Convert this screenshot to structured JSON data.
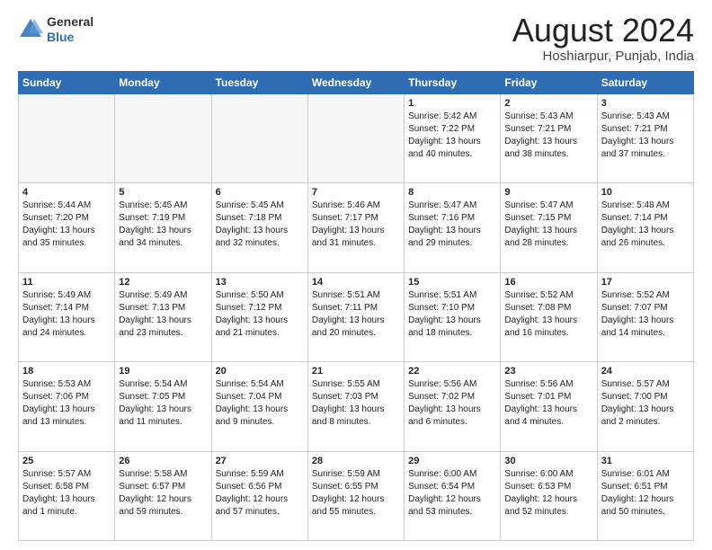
{
  "header": {
    "logo_line1": "General",
    "logo_line2": "Blue",
    "month_title": "August 2024",
    "location": "Hoshiarpur, Punjab, India"
  },
  "days_of_week": [
    "Sunday",
    "Monday",
    "Tuesday",
    "Wednesday",
    "Thursday",
    "Friday",
    "Saturday"
  ],
  "weeks": [
    [
      {
        "num": "",
        "detail": ""
      },
      {
        "num": "",
        "detail": ""
      },
      {
        "num": "",
        "detail": ""
      },
      {
        "num": "",
        "detail": ""
      },
      {
        "num": "1",
        "detail": "Sunrise: 5:42 AM\nSunset: 7:22 PM\nDaylight: 13 hours\nand 40 minutes."
      },
      {
        "num": "2",
        "detail": "Sunrise: 5:43 AM\nSunset: 7:21 PM\nDaylight: 13 hours\nand 38 minutes."
      },
      {
        "num": "3",
        "detail": "Sunrise: 5:43 AM\nSunset: 7:21 PM\nDaylight: 13 hours\nand 37 minutes."
      }
    ],
    [
      {
        "num": "4",
        "detail": "Sunrise: 5:44 AM\nSunset: 7:20 PM\nDaylight: 13 hours\nand 35 minutes."
      },
      {
        "num": "5",
        "detail": "Sunrise: 5:45 AM\nSunset: 7:19 PM\nDaylight: 13 hours\nand 34 minutes."
      },
      {
        "num": "6",
        "detail": "Sunrise: 5:45 AM\nSunset: 7:18 PM\nDaylight: 13 hours\nand 32 minutes."
      },
      {
        "num": "7",
        "detail": "Sunrise: 5:46 AM\nSunset: 7:17 PM\nDaylight: 13 hours\nand 31 minutes."
      },
      {
        "num": "8",
        "detail": "Sunrise: 5:47 AM\nSunset: 7:16 PM\nDaylight: 13 hours\nand 29 minutes."
      },
      {
        "num": "9",
        "detail": "Sunrise: 5:47 AM\nSunset: 7:15 PM\nDaylight: 13 hours\nand 28 minutes."
      },
      {
        "num": "10",
        "detail": "Sunrise: 5:48 AM\nSunset: 7:14 PM\nDaylight: 13 hours\nand 26 minutes."
      }
    ],
    [
      {
        "num": "11",
        "detail": "Sunrise: 5:49 AM\nSunset: 7:14 PM\nDaylight: 13 hours\nand 24 minutes."
      },
      {
        "num": "12",
        "detail": "Sunrise: 5:49 AM\nSunset: 7:13 PM\nDaylight: 13 hours\nand 23 minutes."
      },
      {
        "num": "13",
        "detail": "Sunrise: 5:50 AM\nSunset: 7:12 PM\nDaylight: 13 hours\nand 21 minutes."
      },
      {
        "num": "14",
        "detail": "Sunrise: 5:51 AM\nSunset: 7:11 PM\nDaylight: 13 hours\nand 20 minutes."
      },
      {
        "num": "15",
        "detail": "Sunrise: 5:51 AM\nSunset: 7:10 PM\nDaylight: 13 hours\nand 18 minutes."
      },
      {
        "num": "16",
        "detail": "Sunrise: 5:52 AM\nSunset: 7:08 PM\nDaylight: 13 hours\nand 16 minutes."
      },
      {
        "num": "17",
        "detail": "Sunrise: 5:52 AM\nSunset: 7:07 PM\nDaylight: 13 hours\nand 14 minutes."
      }
    ],
    [
      {
        "num": "18",
        "detail": "Sunrise: 5:53 AM\nSunset: 7:06 PM\nDaylight: 13 hours\nand 13 minutes."
      },
      {
        "num": "19",
        "detail": "Sunrise: 5:54 AM\nSunset: 7:05 PM\nDaylight: 13 hours\nand 11 minutes."
      },
      {
        "num": "20",
        "detail": "Sunrise: 5:54 AM\nSunset: 7:04 PM\nDaylight: 13 hours\nand 9 minutes."
      },
      {
        "num": "21",
        "detail": "Sunrise: 5:55 AM\nSunset: 7:03 PM\nDaylight: 13 hours\nand 8 minutes."
      },
      {
        "num": "22",
        "detail": "Sunrise: 5:56 AM\nSunset: 7:02 PM\nDaylight: 13 hours\nand 6 minutes."
      },
      {
        "num": "23",
        "detail": "Sunrise: 5:56 AM\nSunset: 7:01 PM\nDaylight: 13 hours\nand 4 minutes."
      },
      {
        "num": "24",
        "detail": "Sunrise: 5:57 AM\nSunset: 7:00 PM\nDaylight: 13 hours\nand 2 minutes."
      }
    ],
    [
      {
        "num": "25",
        "detail": "Sunrise: 5:57 AM\nSunset: 6:58 PM\nDaylight: 13 hours\nand 1 minute."
      },
      {
        "num": "26",
        "detail": "Sunrise: 5:58 AM\nSunset: 6:57 PM\nDaylight: 12 hours\nand 59 minutes."
      },
      {
        "num": "27",
        "detail": "Sunrise: 5:59 AM\nSunset: 6:56 PM\nDaylight: 12 hours\nand 57 minutes."
      },
      {
        "num": "28",
        "detail": "Sunrise: 5:59 AM\nSunset: 6:55 PM\nDaylight: 12 hours\nand 55 minutes."
      },
      {
        "num": "29",
        "detail": "Sunrise: 6:00 AM\nSunset: 6:54 PM\nDaylight: 12 hours\nand 53 minutes."
      },
      {
        "num": "30",
        "detail": "Sunrise: 6:00 AM\nSunset: 6:53 PM\nDaylight: 12 hours\nand 52 minutes."
      },
      {
        "num": "31",
        "detail": "Sunrise: 6:01 AM\nSunset: 6:51 PM\nDaylight: 12 hours\nand 50 minutes."
      }
    ]
  ]
}
